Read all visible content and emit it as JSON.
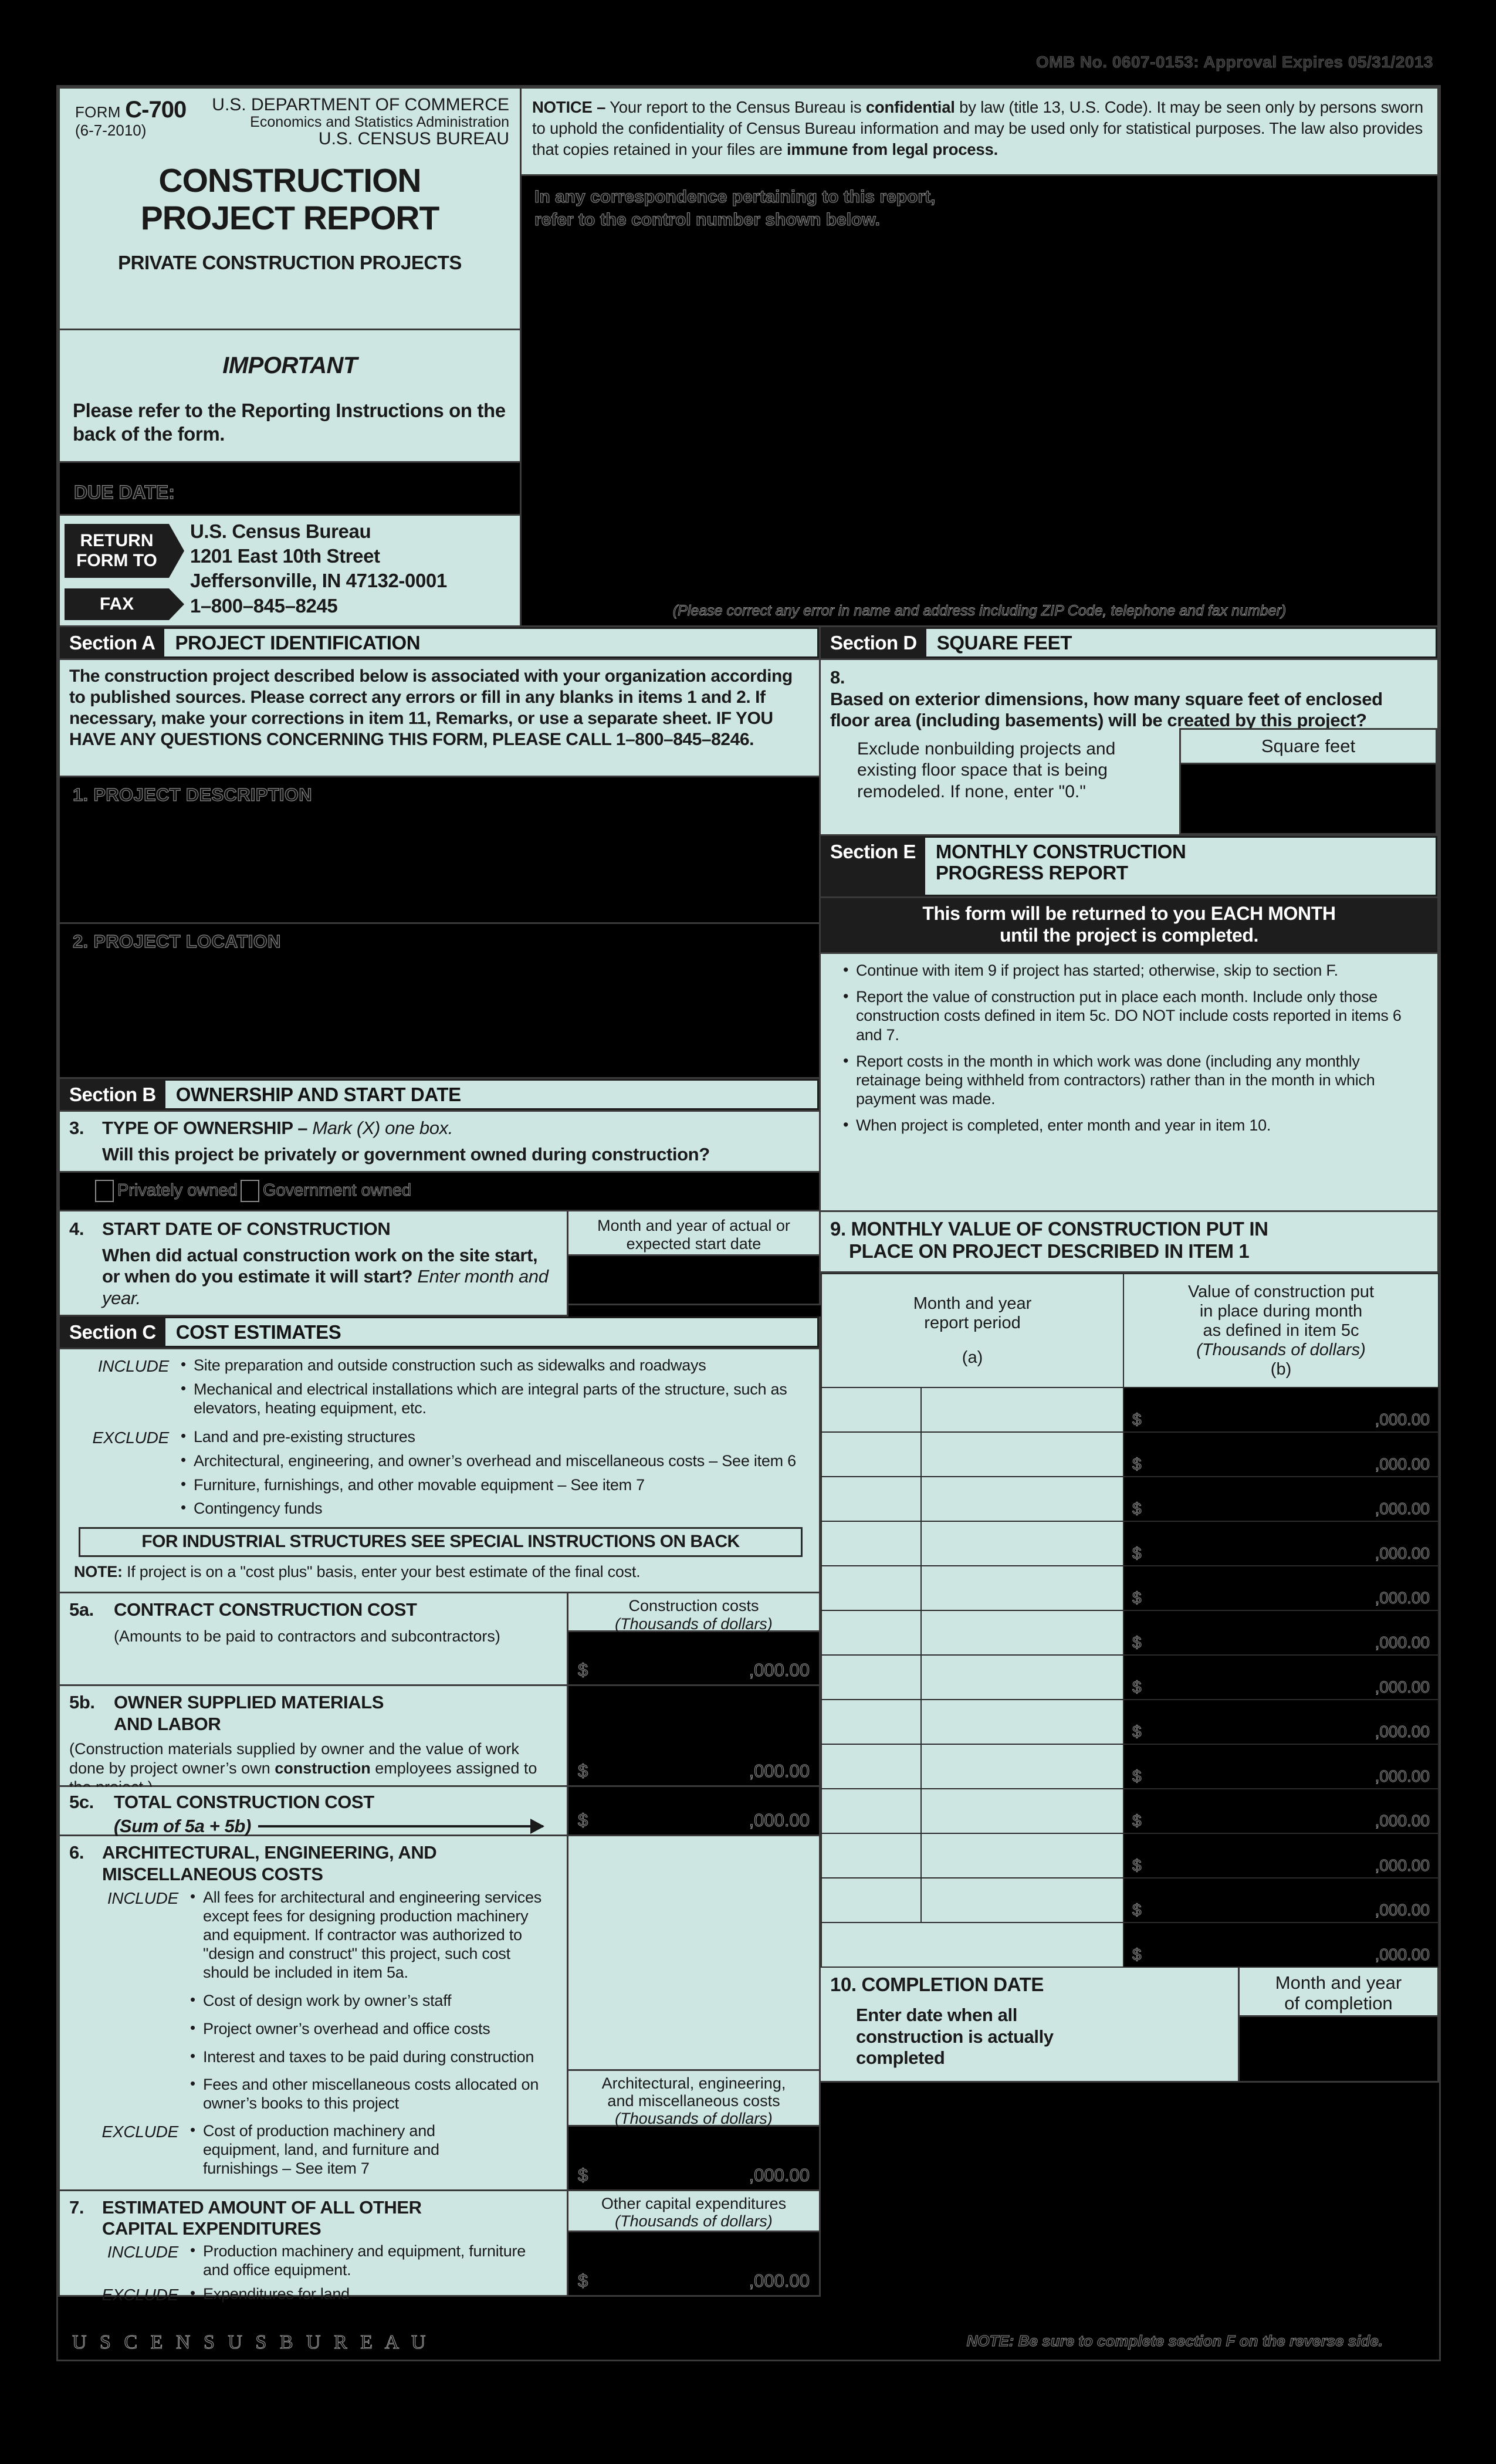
{
  "omb": "OMB No. 0607-0153: Approval Expires 05/31/2013",
  "header": {
    "form_label": "FORM",
    "form_number": "C-700",
    "form_date": "(6-7-2010)",
    "dept_line1": "U.S. DEPARTMENT OF COMMERCE",
    "dept_line2": "Economics and Statistics Administration",
    "dept_line3": "U.S. CENSUS BUREAU",
    "title_line1": "CONSTRUCTION",
    "title_line2": "PROJECT REPORT",
    "subtitle": "PRIVATE CONSTRUCTION PROJECTS"
  },
  "important": {
    "heading": "IMPORTANT",
    "body": "Please refer to the Reporting Instructions on the back of the form."
  },
  "due_date_label": "DUE DATE:",
  "return_to": {
    "tag_line1": "RETURN",
    "tag_line2": "FORM TO",
    "fax_tag": "FAX",
    "addr_line1": "U.S. Census Bureau",
    "addr_line2": "1201 East 10th Street",
    "addr_line3": "Jeffersonville, IN 47132-0001",
    "fax_number": "1–800–845–8245"
  },
  "notice": {
    "label": "NOTICE –",
    "text_1": " Your report to the Census Bureau is ",
    "bold_1": "confidential",
    "text_2": " by law (title 13, U.S. Code). It may be seen only by persons sworn to uphold the confidentiality of Census Bureau information and may be used only for statistical purposes. The law also provides that copies retained in your files are ",
    "bold_2": "immune from legal process."
  },
  "correspondence": {
    "line1": "In any correspondence pertaining to this report,",
    "line2": "refer to the control number shown below.",
    "address_correction": "(Please correct any error in name and address including ZIP Code, telephone and fax number)"
  },
  "section_a": {
    "label": "Section A",
    "title": "PROJECT IDENTIFICATION",
    "intro": "The construction project described below is associated with your organization according to published sources. Please correct any errors or fill in any blanks in items 1 and 2. If necessary, make your corrections in item 11, Remarks, or use a separate sheet. IF YOU HAVE ANY QUESTIONS CONCERNING THIS FORM, PLEASE CALL 1–800–845–8246.",
    "item1_label": "1.  PROJECT DESCRIPTION",
    "item2_label": "2.  PROJECT LOCATION"
  },
  "section_b": {
    "label": "Section B",
    "title": "OWNERSHIP AND START DATE",
    "item3": {
      "number": "3.",
      "title": "TYPE OF OWNERSHIP –",
      "instruction": "Mark (X) one box.",
      "question": "Will this project be privately or government owned during construction?",
      "option_1": "Privately owned",
      "option_2": "Government owned"
    },
    "item4": {
      "number": "4.",
      "title": "START DATE OF CONSTRUCTION",
      "question": "When did actual construction work on the site start, or when do you estimate it will start?",
      "instruction": "Enter month and year.",
      "field_label": "Month and year of actual or expected start date"
    }
  },
  "section_c": {
    "label": "Section C",
    "title": "COST ESTIMATES",
    "include_label": "INCLUDE",
    "exclude_label": "EXCLUDE",
    "include_items": [
      "Site preparation and outside construction such as sidewalks and roadways",
      "Mechanical and electrical installations which are integral parts of the structure, such as elevators, heating equipment, etc."
    ],
    "exclude_items": [
      "Land and pre-existing structures",
      "Architectural, engineering, and owner’s overhead and miscellaneous costs – See item 6",
      "Furniture, furnishings, and other movable equipment – See item 7",
      "Contingency funds"
    ],
    "industrial_note": "FOR INDUSTRIAL STRUCTURES SEE SPECIAL INSTRUCTIONS ON BACK",
    "note_label": "NOTE:",
    "note_text": " If project is on a \"cost plus\" basis, enter your best estimate of the final cost.",
    "item5a": {
      "number": "5a.",
      "title": "CONTRACT CONSTRUCTION COST",
      "sub": "(Amounts to be paid to contractors and subcontractors)",
      "field_label_1": "Construction costs",
      "field_label_2": "(Thousands of dollars)"
    },
    "item5b": {
      "number": "5b.",
      "title_l1": "OWNER SUPPLIED MATERIALS",
      "title_l2": "AND LABOR",
      "sub_1": "(Construction materials supplied by owner and the value of work done by project owner’s own ",
      "sub_bold": "construction",
      "sub_2": " employees assigned to the project.)"
    },
    "item5c": {
      "number": "5c.",
      "title": "TOTAL CONSTRUCTION COST",
      "sub": "(Sum of 5a + 5b)"
    },
    "item6": {
      "number": "6.",
      "title_l1": "ARCHITECTURAL, ENGINEERING, AND",
      "title_l2": "MISCELLANEOUS COSTS",
      "include_items": [
        "All fees for architectural and engineering services except fees for designing production machinery and equipment. If contractor was authorized to \"design and construct\" this project, such cost should be included in item 5a.",
        "Cost of design work by owner’s staff",
        "Project owner’s overhead and office costs",
        "Interest and taxes to be paid during construction",
        "Fees and other miscellaneous costs allocated on owner’s books to this project"
      ],
      "exclude_items": [
        "Cost of production machinery and equipment, land, and furniture and furnishings – See item 7"
      ],
      "field_label_1": "Architectural, engineering,",
      "field_label_2": "and miscellaneous costs",
      "field_label_3": "(Thousands of dollars)"
    },
    "item7": {
      "number": "7.",
      "title_l1": "ESTIMATED AMOUNT OF ALL OTHER",
      "title_l2": "CAPITAL EXPENDITURES",
      "include_items": [
        "Production machinery and equipment, furniture and office equipment."
      ],
      "exclude_items": [
        "Expenditures for land"
      ],
      "field_label_1": "Other capital expenditures",
      "field_label_2": "(Thousands of dollars)"
    }
  },
  "section_d": {
    "label": "Section D",
    "title": "SQUARE FEET",
    "item8": {
      "number": "8.",
      "question": "Based on exterior dimensions, how many square feet of enclosed floor area (including basements) will be created by this project?",
      "note": "Exclude nonbuilding projects and existing floor space that is being remodeled. If none, enter \"0.\"",
      "field_label": "Square feet"
    }
  },
  "section_e": {
    "label": "Section E",
    "title_l1": "MONTHLY CONSTRUCTION",
    "title_l2": "PROGRESS REPORT",
    "banner_l1": "This form will be returned to you EACH MONTH",
    "banner_l2": "until the project is completed.",
    "bullets": [
      "Continue with item 9 if project has started; otherwise, skip to section F.",
      "Report the value of construction put in place each month. Include only those construction costs defined in item 5c. DO NOT include costs reported in items 6 and 7.",
      "Report costs in the month in which work was done (including any monthly retainage being withheld from contractors) rather than in the month in which payment was made.",
      "When project is completed, enter month and year in item 10."
    ],
    "item9": {
      "number": "9.",
      "title_l1": "MONTHLY VALUE OF CONSTRUCTION PUT IN",
      "title_l2": "PLACE ON PROJECT DESCRIBED IN ITEM 1",
      "col_a_l1": "Month and year",
      "col_a_l2": "report period",
      "col_a_key": "(a)",
      "col_b_l1": "Value of construction put",
      "col_b_l2": "in place during month",
      "col_b_l3": "as defined in item 5c",
      "col_b_l4": "(Thousands of dollars)",
      "col_b_key": "(b)",
      "rows": [
        {
          "month": "",
          "value": ""
        },
        {
          "month": "",
          "value": ""
        },
        {
          "month": "",
          "value": ""
        },
        {
          "month": "",
          "value": ""
        },
        {
          "month": "",
          "value": ""
        },
        {
          "month": "",
          "value": ""
        },
        {
          "month": "",
          "value": ""
        },
        {
          "month": "",
          "value": ""
        },
        {
          "month": "",
          "value": ""
        },
        {
          "month": "",
          "value": ""
        },
        {
          "month": "",
          "value": ""
        },
        {
          "month": "",
          "value": ""
        },
        {
          "month": "",
          "value": ""
        }
      ]
    },
    "item10": {
      "number": "10.",
      "title": "COMPLETION DATE",
      "sub": "Enter date when all construction is actually completed",
      "field_label_1": "Month and year",
      "field_label_2": "of completion"
    }
  },
  "money": {
    "dollar": "$",
    "zeros": ",000.00"
  },
  "footer": {
    "logo": "U S C E N S U S B U R E A U",
    "note": "NOTE: Be sure to complete section F on the reverse side."
  },
  "colors": {
    "mint": "#cde6e1",
    "ink": "#1a1a1a",
    "paper_black": "#000000"
  }
}
